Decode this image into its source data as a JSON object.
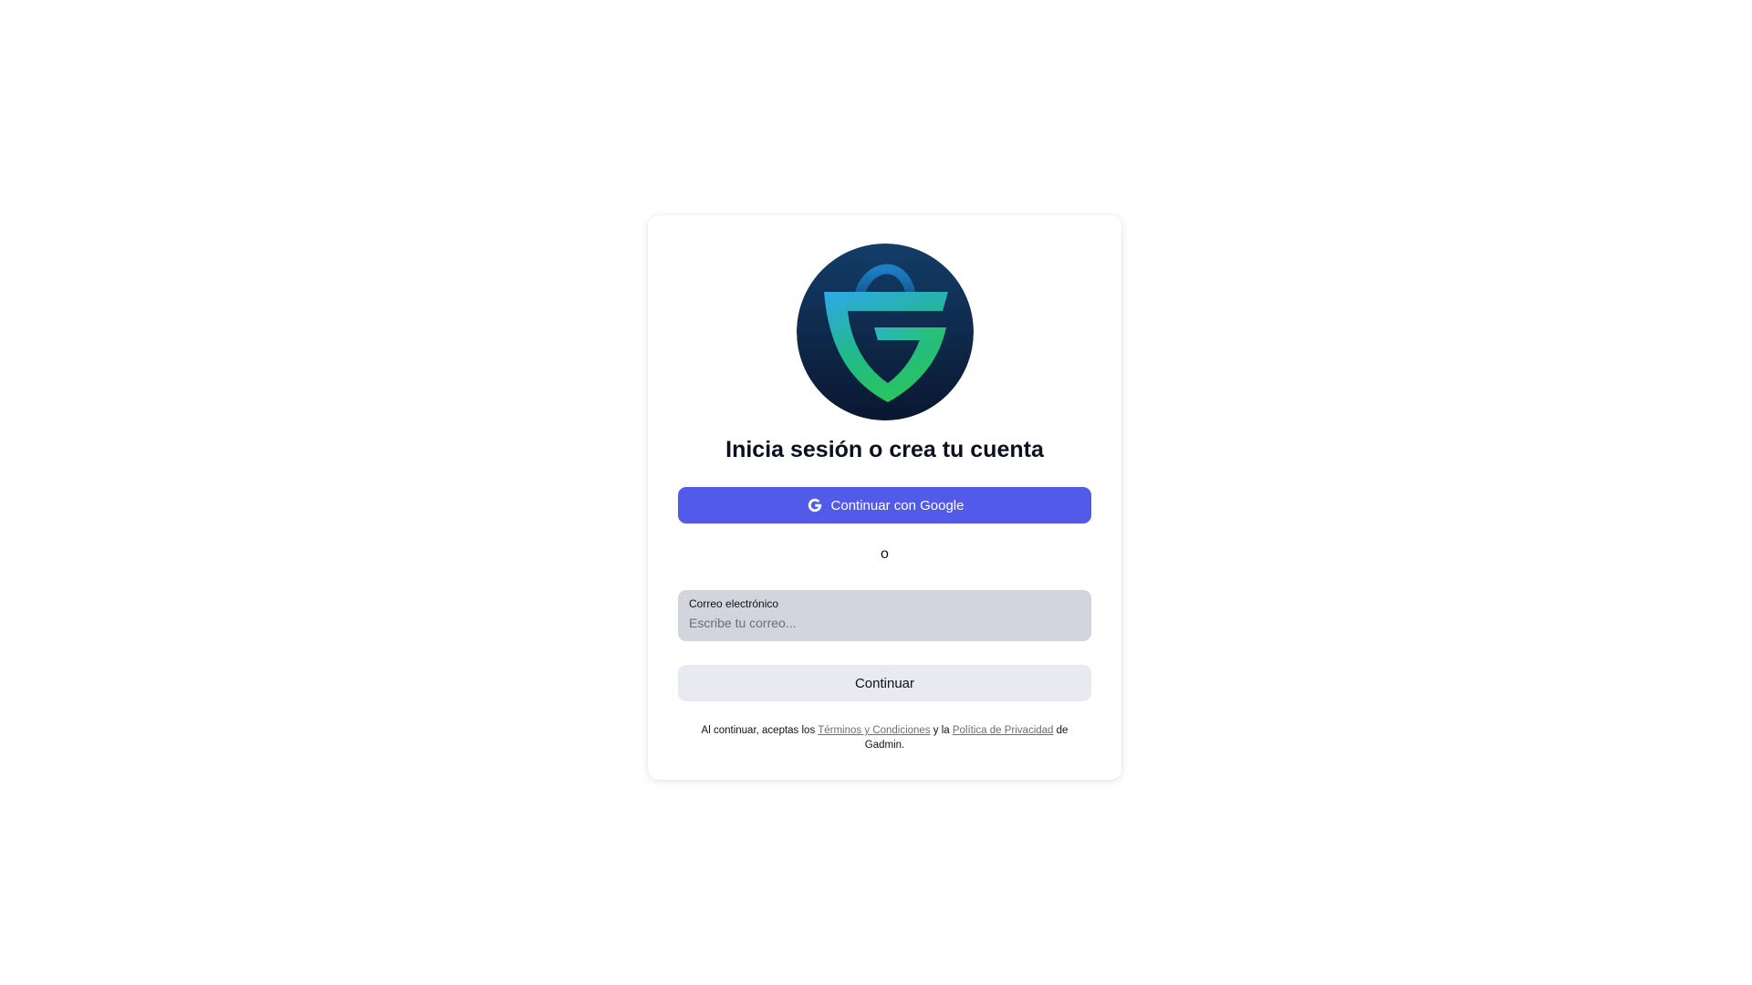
{
  "login": {
    "title": "Inicia sesión o crea tu cuenta",
    "google_button": {
      "label": "Continuar con Google",
      "icon": "google-icon"
    },
    "separator": "o",
    "email": {
      "label": "Correo electrónico",
      "placeholder": "Escribe tu correo...",
      "value": ""
    },
    "continue_button": "Continuar",
    "legal": {
      "prefix": "Al continuar, aceptas los ",
      "terms_link": "Términos y Condiciones",
      "middle": " y la ",
      "privacy_link": "Política de Privacidad",
      "suffix": " de Gadmin."
    }
  },
  "logo": {
    "icon": "gadmin-shopping-bag-shield-logo",
    "colors": {
      "background_top": "#123a63",
      "background_bottom": "#0b1a33",
      "blue": "#2fa5e6",
      "green": "#27c46a"
    }
  },
  "colors": {
    "primary": "#525be9",
    "input_background": "#d2d4de",
    "secondary_button": "#e9e9f2",
    "link": "#6b6e78"
  }
}
